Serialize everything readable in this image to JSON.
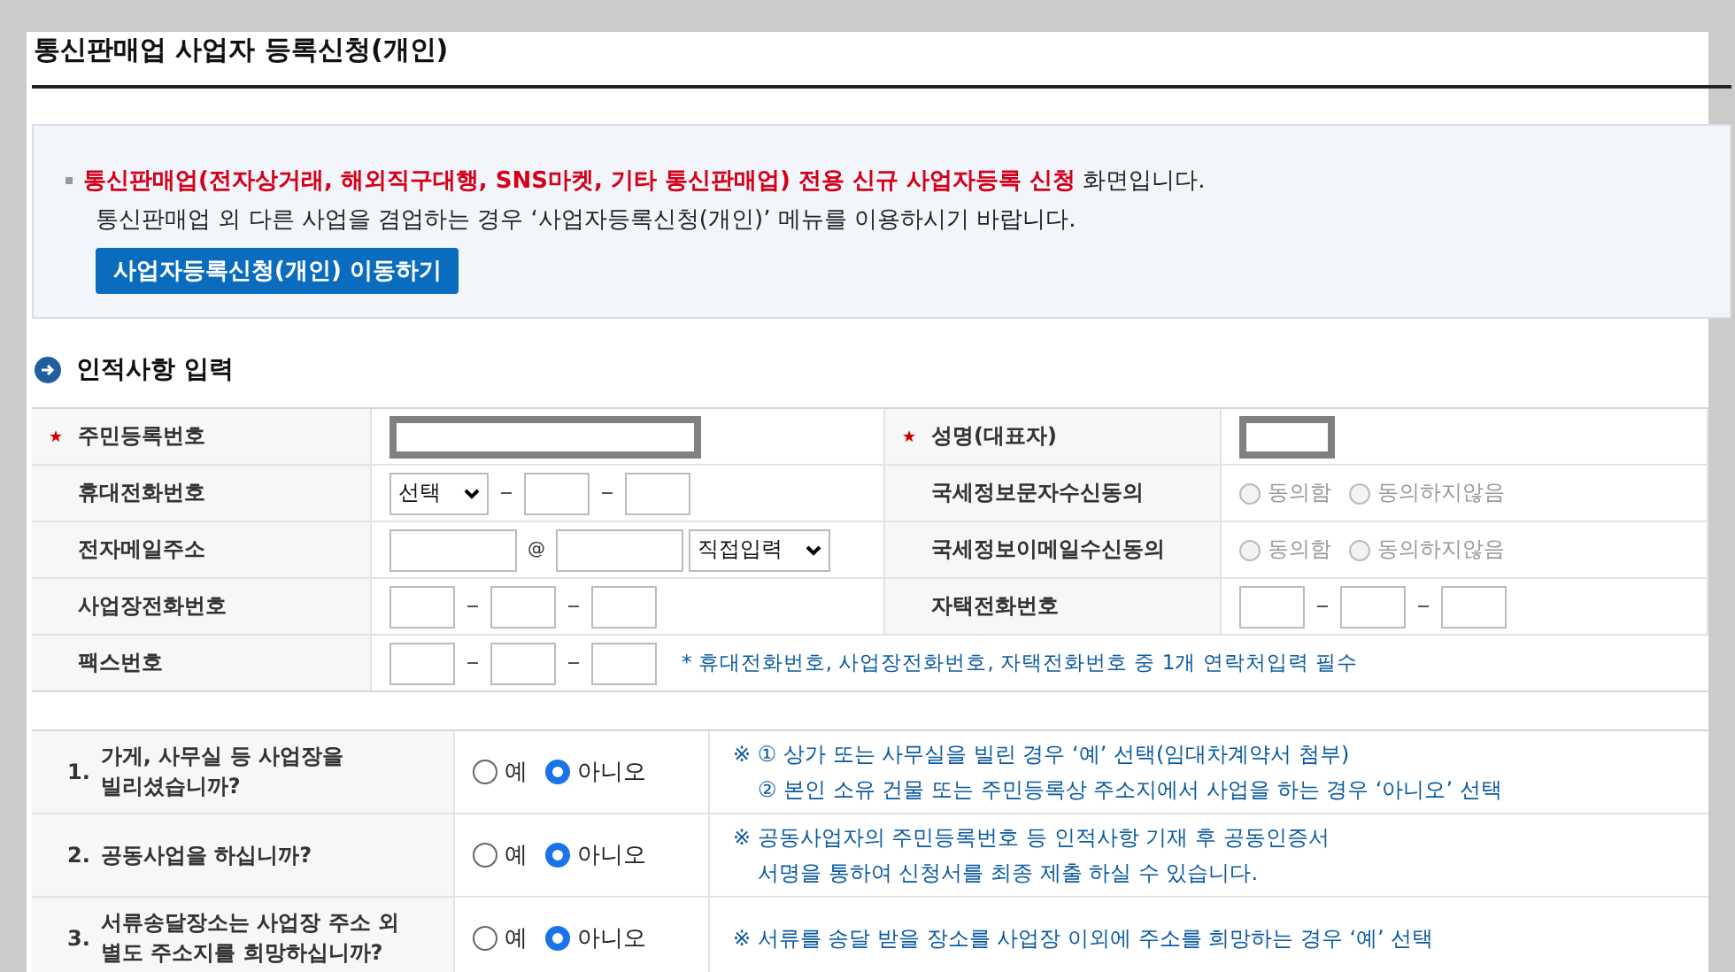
{
  "page_title": "통신판매업 사업자 등록신청(개인)",
  "notice": {
    "highlight": "통신판매업(전자상거래, 해외직구대행, SNS마켓, 기타 통신판매업) 전용 신규 사업자등록 신청",
    "rest": " 화면입니다.",
    "line2": "통신판매업 외 다른 사업을 겸업하는 경우 ‘사업자등록신청(개인)’  메뉴를 이용하시기 바랍니다.",
    "button": "사업자등록신청(개인) 이동하기"
  },
  "section_title": "인적사항 입력",
  "rows": [
    [
      {
        "label": "주민등록번호",
        "required": true,
        "kind": "masked_wide"
      },
      {
        "label": "성명(대표자)",
        "required": true,
        "kind": "masked_short"
      }
    ],
    [
      {
        "label": "휴대전화번호",
        "required": false,
        "kind": "mobile",
        "select": "선택"
      },
      {
        "label": "국세정보문자수신동의",
        "required": false,
        "kind": "consent",
        "disabled": true,
        "options": [
          {
            "label": "동의함",
            "selected": false
          },
          {
            "label": "동의하지않음",
            "selected": false
          }
        ]
      }
    ],
    [
      {
        "label": "전자메일주소",
        "required": false,
        "kind": "email",
        "at": "@",
        "select": "직접입력"
      },
      {
        "label": "국세정보이메일수신동의",
        "required": false,
        "kind": "consent",
        "disabled": true,
        "options": [
          {
            "label": "동의함",
            "selected": false
          },
          {
            "label": "동의하지않음",
            "selected": false
          }
        ]
      }
    ],
    [
      {
        "label": "사업장전화번호",
        "required": false,
        "kind": "phone"
      },
      {
        "label": "자택전화번호",
        "required": false,
        "kind": "phone"
      }
    ],
    [
      {
        "label": "팩스번호",
        "required": false,
        "kind": "phone",
        "note": "* 휴대전화번호, 사업장전화번호, 자택전화번호 중 1개 연락처입력 필수"
      }
    ]
  ],
  "questions": [
    {
      "number": "1.",
      "text": "가게, 사무실 등 사업장을 빌리셨습니까?",
      "options": [
        {
          "label": "예",
          "selected": false
        },
        {
          "label": "아니오",
          "selected": true
        }
      ],
      "notes": [
        "※ ① 상가 또는 사무실을 빌린 경우 ‘예’ 선택(임대차계약서 첨부)",
        "② 본인 소유 건물 또는 주민등록상 주소지에서 사업을 하는 경우 ‘아니오’ 선택"
      ]
    },
    {
      "number": "2.",
      "text": "공동사업을 하십니까?",
      "options": [
        {
          "label": "예",
          "selected": false
        },
        {
          "label": "아니오",
          "selected": true
        }
      ],
      "notes": [
        "※ 공동사업자의 주민등록번호 등 인적사항 기재 후 공동인증서",
        "서명을 통하여 신청서를 최종 제출 하실 수 있습니다."
      ]
    },
    {
      "number": "3.",
      "text": "서류송달장소는 사업장 주소 외 별도 주소지를 희망하십니까?",
      "options": [
        {
          "label": "예",
          "selected": false
        },
        {
          "label": "아니오",
          "selected": true
        }
      ],
      "notes": [
        "※ 서류를 송달 받을 장소를 사업장 이외에 주소를 희망하는 경우 ‘예’ 선택"
      ]
    }
  ]
}
